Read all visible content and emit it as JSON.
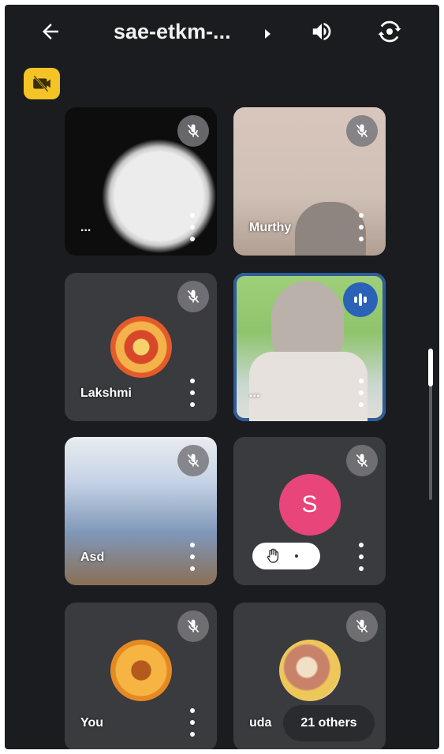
{
  "app": {
    "meeting_title": "sae-etkm-...",
    "back_icon": "arrow-left-icon",
    "speaker_icon": "speaker-icon",
    "camera_switch_icon": "camera-switch-icon",
    "camera_off_icon": "camera-off-icon",
    "accent": "#f4c326"
  },
  "participants": [
    {
      "name": "...",
      "muted": true,
      "feed": "video"
    },
    {
      "name": "Murthy",
      "muted": true,
      "feed": "video"
    },
    {
      "name": "Lakshmi",
      "muted": true,
      "feed": "avatar"
    },
    {
      "name": "...",
      "muted": false,
      "speaking": true,
      "feed": "video",
      "border_color": "#2f5d99"
    },
    {
      "name": "Asd",
      "muted": true,
      "feed": "video"
    },
    {
      "name": "",
      "muted": true,
      "feed": "letter",
      "letter": "S",
      "letter_color": "#e8457a",
      "hand_raised": true
    },
    {
      "name": "You",
      "muted": true,
      "feed": "avatar"
    },
    {
      "name": "uda",
      "muted": true,
      "feed": "avatar"
    }
  ],
  "others_label": "21 others",
  "icons": {
    "mute": "mic-off-icon",
    "speaking": "audio-level-icon",
    "more": "more-vert-icon",
    "hand": "raised-hand-icon"
  }
}
